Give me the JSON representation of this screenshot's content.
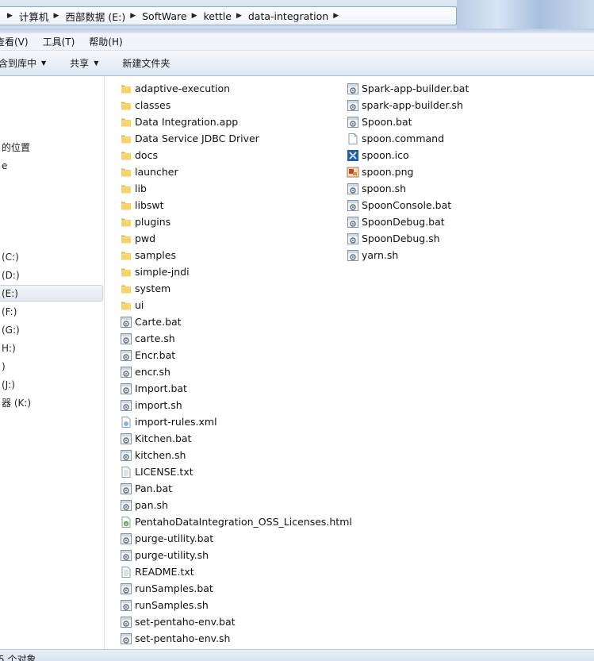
{
  "breadcrumb": [
    {
      "label": "计算机"
    },
    {
      "label": "西部数据 (E:)"
    },
    {
      "label": "SoftWare"
    },
    {
      "label": "kettle"
    },
    {
      "label": "data-integration"
    }
  ],
  "menu": {
    "view": "查看(V)",
    "tools": "工具(T)",
    "help": "帮助(H)"
  },
  "toolbar": {
    "include_library": "含到库中",
    "share": "共享",
    "new_folder": "新建文件夹"
  },
  "nav": {
    "items": [
      {
        "label": "的位置"
      },
      {
        "label": "e"
      },
      {
        "label": " (C:)"
      },
      {
        "label": " (D:)"
      },
      {
        "label": " (E:)"
      },
      {
        "label": " (F:)"
      },
      {
        "label": " (G:)"
      },
      {
        "label": "H:)"
      },
      {
        "label": ")"
      },
      {
        "label": " (J:)"
      },
      {
        "label": "器 (K:)"
      }
    ]
  },
  "files": {
    "col1": [
      {
        "name": "adaptive-execution",
        "icon": "folder-icon"
      },
      {
        "name": "classes",
        "icon": "folder-icon"
      },
      {
        "name": "Data Integration.app",
        "icon": "folder-icon"
      },
      {
        "name": "Data Service JDBC Driver",
        "icon": "folder-icon"
      },
      {
        "name": "docs",
        "icon": "folder-icon"
      },
      {
        "name": "launcher",
        "icon": "folder-icon"
      },
      {
        "name": "lib",
        "icon": "folder-icon"
      },
      {
        "name": "libswt",
        "icon": "folder-icon"
      },
      {
        "name": "plugins",
        "icon": "folder-icon"
      },
      {
        "name": "pwd",
        "icon": "folder-icon"
      },
      {
        "name": "samples",
        "icon": "folder-icon"
      },
      {
        "name": "simple-jndi",
        "icon": "folder-icon"
      },
      {
        "name": "system",
        "icon": "folder-icon"
      },
      {
        "name": "ui",
        "icon": "folder-icon"
      },
      {
        "name": "Carte.bat",
        "icon": "script-icon"
      },
      {
        "name": "carte.sh",
        "icon": "script-icon"
      },
      {
        "name": "Encr.bat",
        "icon": "script-icon"
      },
      {
        "name": "encr.sh",
        "icon": "script-icon"
      },
      {
        "name": "Import.bat",
        "icon": "script-icon"
      },
      {
        "name": "import.sh",
        "icon": "script-icon"
      },
      {
        "name": "import-rules.xml",
        "icon": "xml-icon"
      },
      {
        "name": "Kitchen.bat",
        "icon": "script-icon"
      },
      {
        "name": "kitchen.sh",
        "icon": "script-icon"
      },
      {
        "name": "LICENSE.txt",
        "icon": "text-file-icon"
      },
      {
        "name": "Pan.bat",
        "icon": "script-icon"
      },
      {
        "name": "pan.sh",
        "icon": "script-icon"
      },
      {
        "name": "PentahoDataIntegration_OSS_Licenses.html",
        "icon": "html-icon"
      },
      {
        "name": "purge-utility.bat",
        "icon": "script-icon"
      },
      {
        "name": "purge-utility.sh",
        "icon": "script-icon"
      },
      {
        "name": "README.txt",
        "icon": "text-file-icon"
      },
      {
        "name": "runSamples.bat",
        "icon": "script-icon"
      },
      {
        "name": "runSamples.sh",
        "icon": "script-icon"
      },
      {
        "name": "set-pentaho-env.bat",
        "icon": "script-icon"
      },
      {
        "name": "set-pentaho-env.sh",
        "icon": "script-icon"
      }
    ],
    "col2": [
      {
        "name": "Spark-app-builder.bat",
        "icon": "script-icon"
      },
      {
        "name": "spark-app-builder.sh",
        "icon": "script-icon"
      },
      {
        "name": "Spoon.bat",
        "icon": "script-icon"
      },
      {
        "name": "spoon.command",
        "icon": "blank-file-icon"
      },
      {
        "name": "spoon.ico",
        "icon": "ico-file-icon"
      },
      {
        "name": "spoon.png",
        "icon": "png-file-icon"
      },
      {
        "name": "spoon.sh",
        "icon": "script-icon"
      },
      {
        "name": "SpoonConsole.bat",
        "icon": "script-icon"
      },
      {
        "name": "SpoonDebug.bat",
        "icon": "script-icon"
      },
      {
        "name": "SpoonDebug.sh",
        "icon": "script-icon"
      },
      {
        "name": "yarn.sh",
        "icon": "script-icon"
      }
    ]
  },
  "status": {
    "text": "5 个对象"
  }
}
